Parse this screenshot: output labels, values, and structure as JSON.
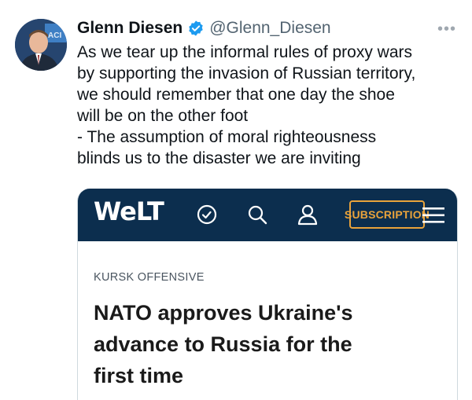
{
  "author": {
    "name": "Glenn Diesen",
    "handle": "@Glenn_Diesen",
    "verified_color": "#1d9bf0"
  },
  "more_label": "•••",
  "tweet_lines": [
    "As we tear up the informal rules of proxy wars",
    "by supporting the invasion of Russian territory,",
    "we should remember that one day the shoe",
    "will be on the other foot",
    "- The assumption of moral righteousness",
    "blinds us to the disaster we are inviting"
  ],
  "article": {
    "logo": "WeLT",
    "nav_icons": [
      "clock-check-icon",
      "search-icon",
      "user-icon",
      "menu-icon"
    ],
    "subscribe_label": "SUBSCRIPTION",
    "kicker": "KURSK OFFENSIVE",
    "headline_lines": [
      "NATO approves Ukraine's",
      "advance to Russia for the",
      "first time"
    ],
    "nav_color": "#0c2e4e",
    "accent_color": "#e9a33b"
  }
}
